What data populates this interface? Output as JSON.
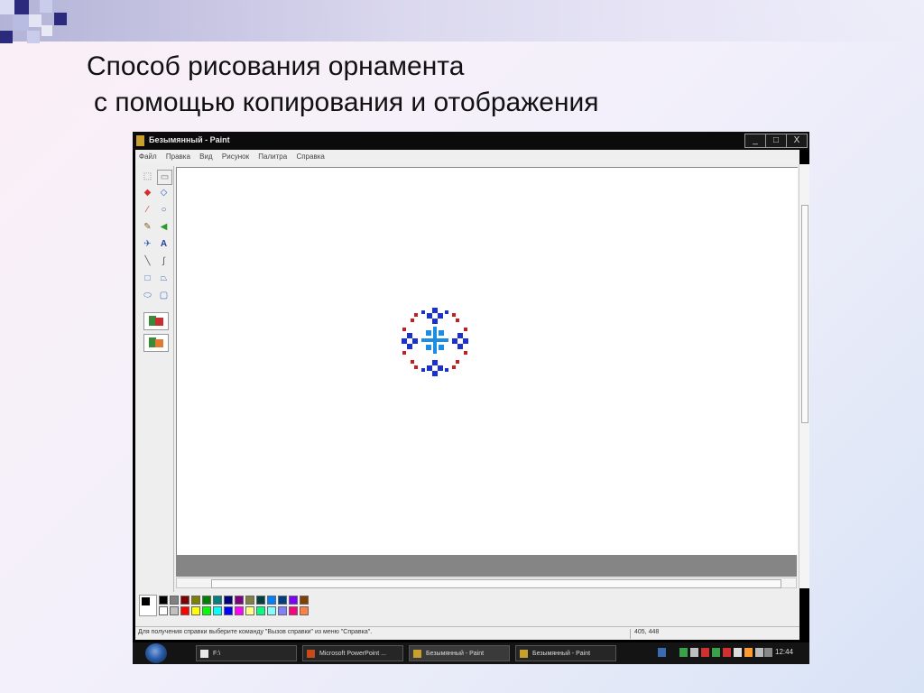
{
  "slide": {
    "title_line1": "Способ рисования орнамента",
    "title_line2": "с помощью копирования и отображения"
  },
  "window": {
    "title": "Безымянный - Paint",
    "minimize": "_",
    "maximize": "□",
    "close": "X"
  },
  "menu": [
    "Файл",
    "Правка",
    "Вид",
    "Рисунок",
    "Палитра",
    "Справка"
  ],
  "status": {
    "hint": "Для получения справки выберите команду \"Вызов справки\" из меню \"Справка\".",
    "coords": "405, 448"
  },
  "taskbar": {
    "tasks": [
      "F:\\",
      "Microsoft PowerPoint ...",
      "Безымянный - Paint",
      "Безымянный - Paint"
    ],
    "clock": "12:44"
  },
  "palette": {
    "row1": [
      "#000000",
      "#808080",
      "#800000",
      "#808000",
      "#008000",
      "#008080",
      "#000080",
      "#800080",
      "#808040",
      "#004040",
      "#0080ff",
      "#004080",
      "#8000ff",
      "#804000"
    ],
    "row2": [
      "#ffffff",
      "#c0c0c0",
      "#ff0000",
      "#ffff00",
      "#00ff00",
      "#00ffff",
      "#0000ff",
      "#ff00ff",
      "#ffff80",
      "#00ff80",
      "#80ffff",
      "#8080ff",
      "#ff0080",
      "#ff8040"
    ]
  },
  "colors": {
    "ornament_blue": "#1b2fd6",
    "ornament_red": "#c91c1c",
    "ornament_cyan": "#1c8de0"
  }
}
